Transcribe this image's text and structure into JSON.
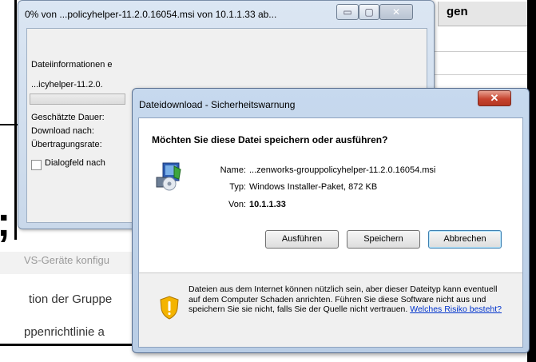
{
  "background": {
    "tab_label": "gen",
    "gray_text": "VS-Geräte konfigu",
    "text_line1": "tion der Gruppe",
    "text_line2": "ppenrichtlinie a",
    "big_glyph": ";"
  },
  "download_window": {
    "title": "0% von ...policyhelper-11.2.0.16054.msi von 10.1.1.33 ab...",
    "caption_buttons": {
      "minimize": "▭",
      "maximize": "▢",
      "close": "✕"
    },
    "file_info_label": "Dateiinformationen e",
    "file_name": "...icyhelper-11.2.0.",
    "progress_percent": 0,
    "estimated_time_label": "Geschätzte Dauer:",
    "download_to_label": "Download nach:",
    "transfer_rate_label": "Übertragungsrate:",
    "close_dialog_checkbox_label": "Dialogfeld nach"
  },
  "security_dialog": {
    "title": "Dateidownload - Sicherheitswarnung",
    "close_glyph": "✕",
    "question": "Möchten Sie diese Datei speichern oder ausführen?",
    "fields": {
      "name_label": "Name:",
      "name_value": "...zenworks-grouppolicyhelper-11.2.0.16054.msi",
      "type_label": "Typ:",
      "type_value": "Windows Installer-Paket, 872 KB",
      "from_label": "Von:",
      "from_value": "10.1.1.33"
    },
    "buttons": {
      "run": "Ausführen",
      "save": "Speichern",
      "cancel": "Abbrechen"
    },
    "warning_text": "Dateien aus dem Internet können nützlich sein, aber dieser Dateityp kann eventuell auf dem Computer Schaden anrichten. Führen Sie diese Software nicht aus und speichern Sie sie nicht, falls Sie der Quelle nicht vertrauen. ",
    "warning_link": "Welches Risiko besteht?",
    "icons": {
      "file": "msi-installer-icon",
      "warning": "security-shield-icon"
    }
  }
}
